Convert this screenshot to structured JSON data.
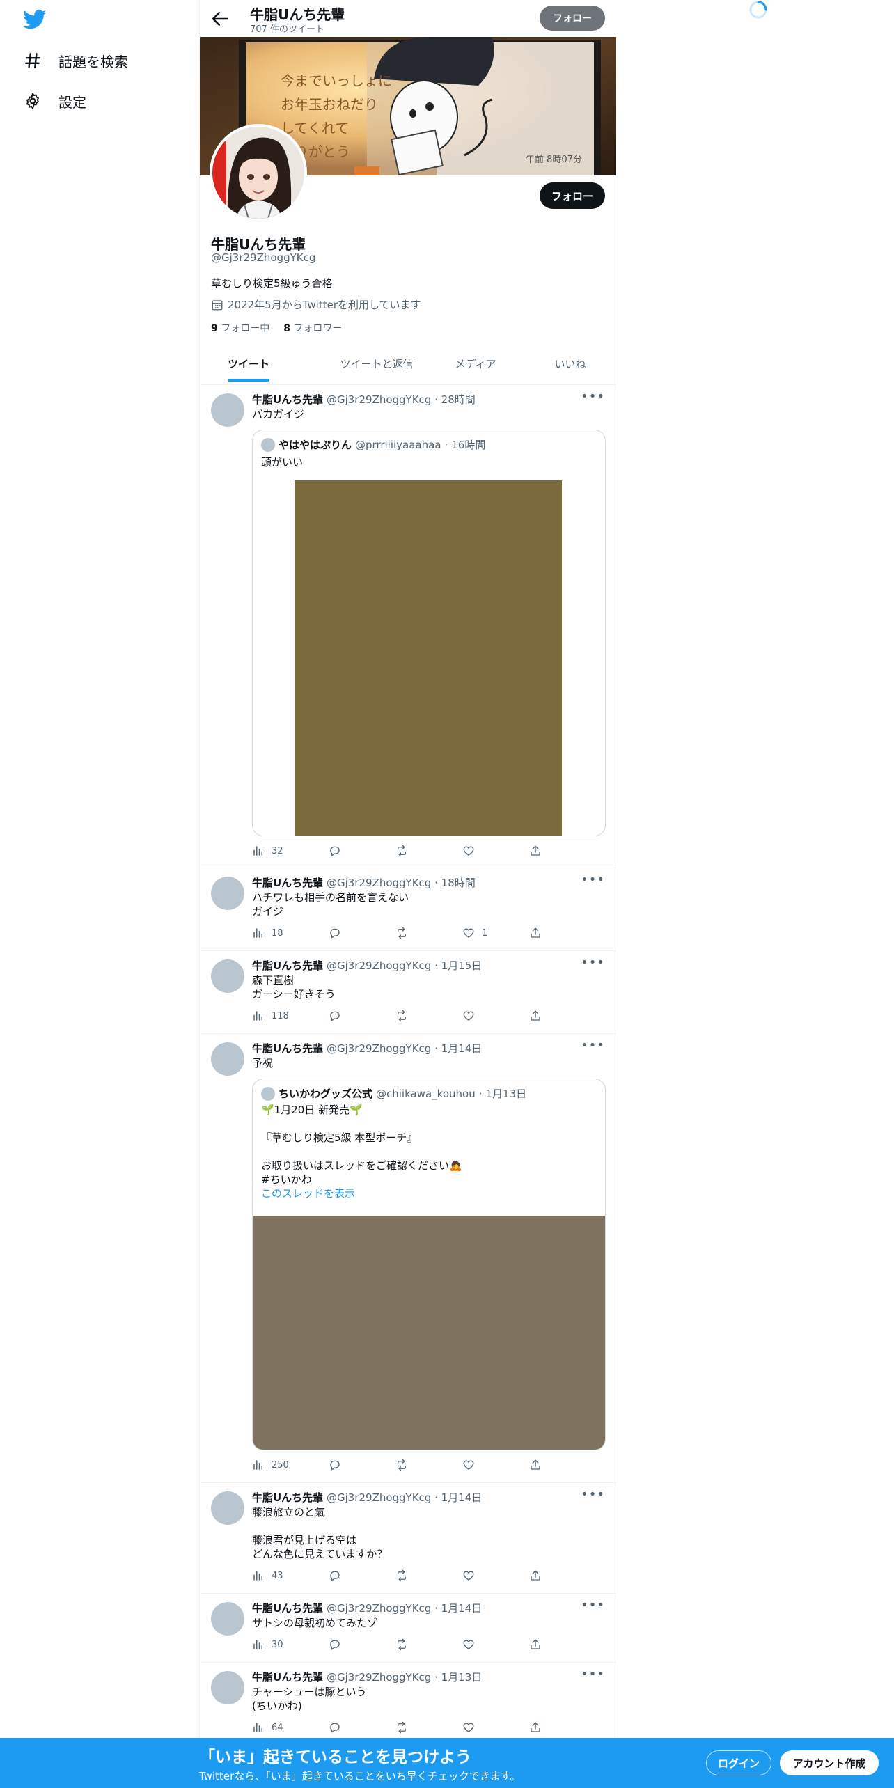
{
  "nav": {
    "logo_icon": "twitter-bird-icon",
    "items": [
      {
        "icon": "hashtag-icon",
        "label": "話題を検索"
      },
      {
        "icon": "gear-icon",
        "label": "設定"
      }
    ]
  },
  "header": {
    "name": "牛脂Uんち先輩",
    "tweet_count": "707 件のツイート",
    "follow_label": "フォロー"
  },
  "profile": {
    "follow_label": "フォロー",
    "name": "牛脂Uんち先輩",
    "handle": "@Gj3r29ZhoggYKcg",
    "bio": "草むしり検定5級ゅう合格",
    "joined": "2022年5月からTwitterを利用しています",
    "following_count": "9",
    "following_label": "フォロー中",
    "followers_count": "8",
    "followers_label": "フォロワー",
    "banner_texts": {
      "sign": "今までいっしょに\nお年玉おねだり\nしてくれて\nありがとう",
      "corner": "午前 8時07分"
    }
  },
  "tabs": [
    "ツイート",
    "ツイートと返信",
    "メディア",
    "いいね"
  ],
  "tweets": [
    {
      "name": "牛脂Uんち先輩",
      "handle": "@Gj3r29ZhoggYKcg",
      "time": "28時間",
      "text": "バカガイジ",
      "quote": {
        "name": "やはやはぷりん",
        "handle": "@prrriiiiyaaahaa",
        "time": "16時間",
        "text": "頭がいい",
        "media_color": "#7b6a3c"
      },
      "views": "32",
      "likes": ""
    },
    {
      "name": "牛脂Uんち先輩",
      "handle": "@Gj3r29ZhoggYKcg",
      "time": "18時間",
      "text": "ハチワレも相手の名前を言えない\nガイジ",
      "views": "18",
      "likes": "1"
    },
    {
      "name": "牛脂Uんち先輩",
      "handle": "@Gj3r29ZhoggYKcg",
      "time": "1月15日",
      "text": "森下直樹\nガーシー好きそう",
      "views": "118",
      "likes": ""
    },
    {
      "name": "牛脂Uんち先輩",
      "handle": "@Gj3r29ZhoggYKcg",
      "time": "1月14日",
      "text": "予祝",
      "quote": {
        "name": "ちいかわグッズ公式",
        "handle": "@chiikawa_kouhou",
        "time": "1月13日",
        "text": "🌱1月20日 新発売🌱\n\n『草むしり検定5級 本型ポーチ』\n\nお取り扱いはスレッドをご確認ください🙇\n#ちいかわ",
        "link": "このスレッドを表示",
        "media_color": "#7f725f"
      },
      "views": "250",
      "likes": ""
    },
    {
      "name": "牛脂Uんち先輩",
      "handle": "@Gj3r29ZhoggYKcg",
      "time": "1月14日",
      "text": "藤浪旅立のと氣\n\n藤浪君が見上げる空は\nどんな色に見えていますか？",
      "views": "43",
      "likes": ""
    },
    {
      "name": "牛脂Uんち先輩",
      "handle": "@Gj3r29ZhoggYKcg",
      "time": "1月14日",
      "text": "サトシの母親初めてみたゾ",
      "views": "30",
      "likes": ""
    },
    {
      "name": "牛脂Uんち先輩",
      "handle": "@Gj3r29ZhoggYKcg",
      "time": "1月13日",
      "text": "チャーシューは豚という\n(ちいかわ)",
      "views": "64",
      "likes": ""
    }
  ],
  "bottom_bar": {
    "title": "「いま」起きていることを見つけよう",
    "subtitle": "Twitterなら、「いま」起きていることをいち早くチェックできます。",
    "login_label": "ログイン",
    "signup_label": "アカウント作成"
  },
  "colors": {
    "accent": "#1d9bf0",
    "text": "#0f1419",
    "secondary": "#536471"
  }
}
